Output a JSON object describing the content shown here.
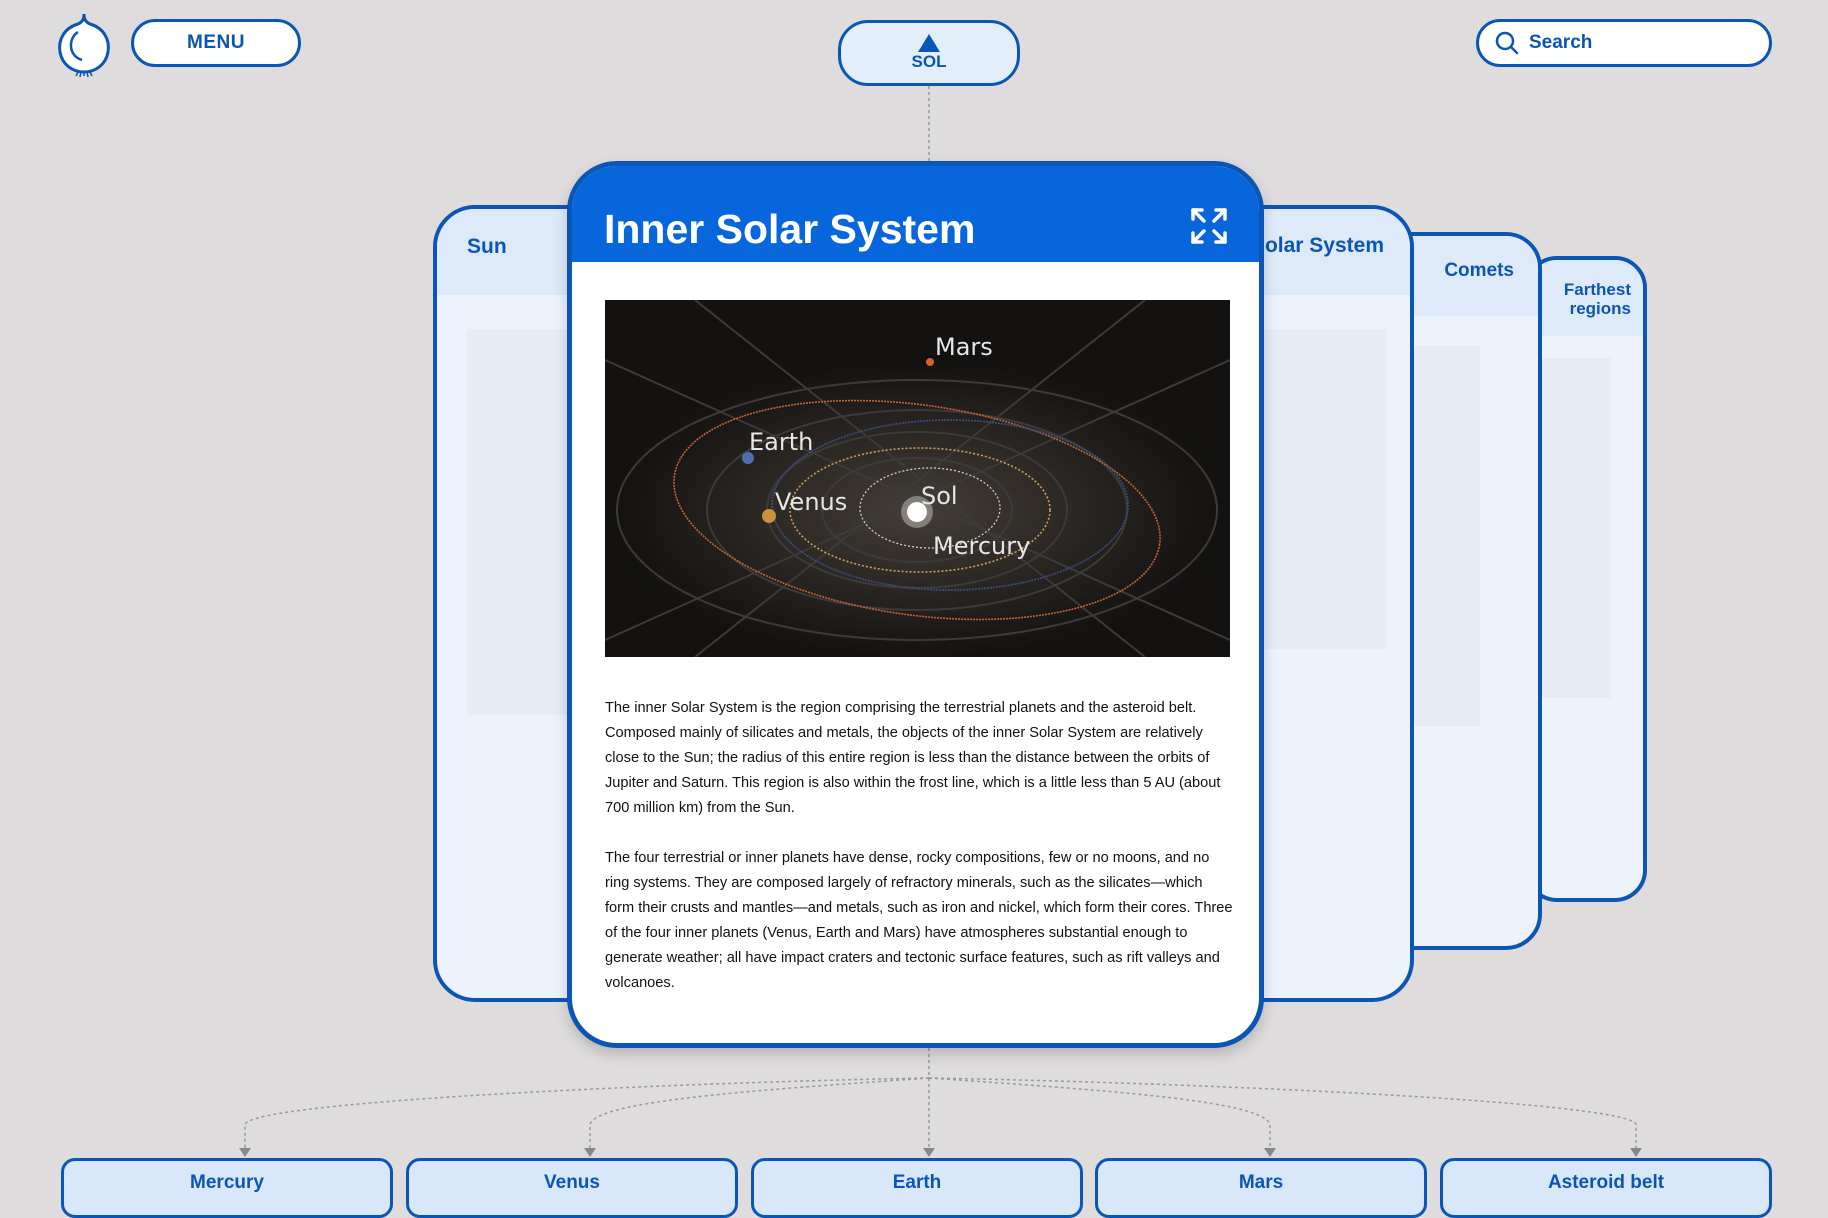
{
  "header": {
    "menu_label": "MENU",
    "search_placeholder": "Search",
    "parent_label": "SOL"
  },
  "cards": {
    "left": {
      "title": "Sun"
    },
    "main": {
      "title": "Inner Solar System",
      "image_labels": [
        "Mars",
        "Earth",
        "Venus",
        "Sol",
        "Mercury"
      ],
      "paragraphs": [
        "The inner Solar System is the region comprising the terrestrial planets and the asteroid belt. Composed mainly of silicates and metals, the objects of the inner Solar System are relatively close to the Sun; the radius of this entire region is less than the distance between the orbits of Jupiter and Saturn. This region is also within the frost line, which is a little less than 5 AU (about 700 million km) from the Sun.",
        "The four terrestrial or inner planets have dense, rocky compositions, few or no moons, and no ring systems. They are composed largely of refractory minerals, such as the silicates—which form their crusts and mantles—and metals, such as iron and nickel, which form their cores. Three of the four inner planets (Venus, Earth and Mars) have atmospheres substantial enough to generate weather; all have impact craters and tectonic surface features, such as rift valleys and volcanoes."
      ]
    },
    "right1": {
      "title": "Outer Solar System"
    },
    "right2": {
      "title": "Comets"
    },
    "right3": {
      "title": "Farthest regions"
    }
  },
  "children": [
    "Mercury",
    "Venus",
    "Earth",
    "Mars",
    "Asteroid belt"
  ],
  "colors": {
    "accent": "#0766dc",
    "border": "#0b56b5",
    "background": "#dedcdd"
  }
}
